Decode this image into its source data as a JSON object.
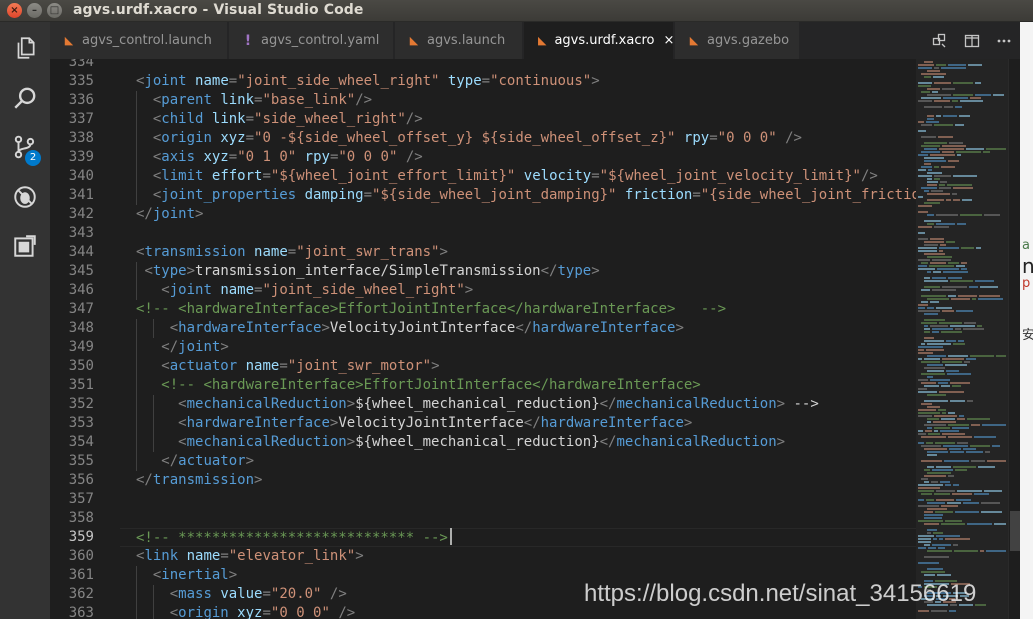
{
  "window": {
    "title": "agvs.urdf.xacro - Visual Studio Code",
    "controls": [
      "close-icon",
      "minimize-icon",
      "maximize-icon"
    ]
  },
  "activity_bar": {
    "items": [
      {
        "icon": "files-icon"
      },
      {
        "icon": "search-icon"
      },
      {
        "icon": "source-control-icon",
        "badge": "2"
      },
      {
        "icon": "debug-icon"
      },
      {
        "icon": "extensions-icon"
      }
    ]
  },
  "tabs": [
    {
      "label": "agvs_control.launch",
      "icon": "rss-icon"
    },
    {
      "label": "agvs_control.yaml",
      "icon": "yaml-icon"
    },
    {
      "label": "agvs.launch",
      "icon": "rss-icon"
    },
    {
      "label": "agvs.urdf.xacro",
      "icon": "rss-icon",
      "active": true,
      "close": "×"
    },
    {
      "label": "agvs.gazebo",
      "icon": "rss-icon"
    }
  ],
  "tab_actions": [
    "open-changes-icon",
    "split-editor-icon",
    "more-icon"
  ],
  "editor": {
    "current_line": 359,
    "lines": [
      {
        "n": "334",
        "code": "",
        "guides": 0
      },
      {
        "n": "335",
        "code": "<joint name=\"joint_side_wheel_right\" type=\"continuous\">",
        "guides": 0
      },
      {
        "n": "336",
        "code": "  <parent link=\"base_link\"/>",
        "guides": 1
      },
      {
        "n": "337",
        "code": "  <child link=\"side_wheel_right\"/>",
        "guides": 1
      },
      {
        "n": "338",
        "code": "  <origin xyz=\"0 -${side_wheel_offset_y} ${side_wheel_offset_z}\" rpy=\"0 0 0\" />",
        "guides": 1
      },
      {
        "n": "339",
        "code": "  <axis xyz=\"0 1 0\" rpy=\"0 0 0\" />",
        "guides": 1
      },
      {
        "n": "340",
        "code": "  <limit effort=\"${wheel_joint_effort_limit}\" velocity=\"${wheel_joint_velocity_limit}\"/>",
        "guides": 1
      },
      {
        "n": "341",
        "code": "  <joint_properties damping=\"${side_wheel_joint_damping}\" friction=\"{side_wheel_joint_frictio",
        "guides": 1
      },
      {
        "n": "342",
        "code": "</joint>",
        "guides": 0
      },
      {
        "n": "343",
        "code": "",
        "guides": 0
      },
      {
        "n": "344",
        "code": "<transmission name=\"joint_swr_trans\">",
        "guides": 0
      },
      {
        "n": "345",
        "code": " <type>transmission_interface/SimpleTransmission</type>",
        "guides": 1
      },
      {
        "n": "346",
        "code": "   <joint name=\"joint_side_wheel_right\">",
        "guides": 1
      },
      {
        "n": "347",
        "code": "<!-- <hardwareInterface>EffortJointInterface</hardwareInterface>   -->",
        "guides": 0
      },
      {
        "n": "348",
        "code": "    <hardwareInterface>VelocityJointInterface</hardwareInterface>",
        "guides": 2
      },
      {
        "n": "349",
        "code": "   </joint>",
        "guides": 1
      },
      {
        "n": "350",
        "code": "   <actuator name=\"joint_swr_motor\">",
        "guides": 1
      },
      {
        "n": "351",
        "code": "   <!-- <hardwareInterface>EffortJointInterface</hardwareInterface>",
        "guides": 1
      },
      {
        "n": "352",
        "code": "     <mechanicalReduction>${wheel_mechanical_reduction}</mechanicalReduction> -->",
        "guides": 2
      },
      {
        "n": "353",
        "code": "     <hardwareInterface>VelocityJointInterface</hardwareInterface>",
        "guides": 2
      },
      {
        "n": "354",
        "code": "     <mechanicalReduction>${wheel_mechanical_reduction}</mechanicalReduction>",
        "guides": 2
      },
      {
        "n": "355",
        "code": "   </actuator>",
        "guides": 1
      },
      {
        "n": "356",
        "code": "</transmission>",
        "guides": 0
      },
      {
        "n": "357",
        "code": "",
        "guides": 0
      },
      {
        "n": "358",
        "code": "",
        "guides": 0
      },
      {
        "n": "359",
        "code": "<!-- **************************** -->",
        "guides": 0
      },
      {
        "n": "360",
        "code": "<link name=\"elevator_link\">",
        "guides": 0
      },
      {
        "n": "361",
        "code": "  <inertial>",
        "guides": 1
      },
      {
        "n": "362",
        "code": "    <mass value=\"20.0\" />",
        "guides": 2
      },
      {
        "n": "363",
        "code": "    <origin xyz=\"0 0 0\" />",
        "guides": 2
      }
    ]
  },
  "background_window": {
    "fragments": [
      "a",
      "n",
      "p",
      "安"
    ]
  },
  "watermark": "https://blog.csdn.net/sinat_34156619",
  "colors": {
    "tag": "#569cd6",
    "attribute": "#9cdcfe",
    "string": "#ce9178",
    "comment": "#6a9955",
    "accent": "#007acc"
  }
}
